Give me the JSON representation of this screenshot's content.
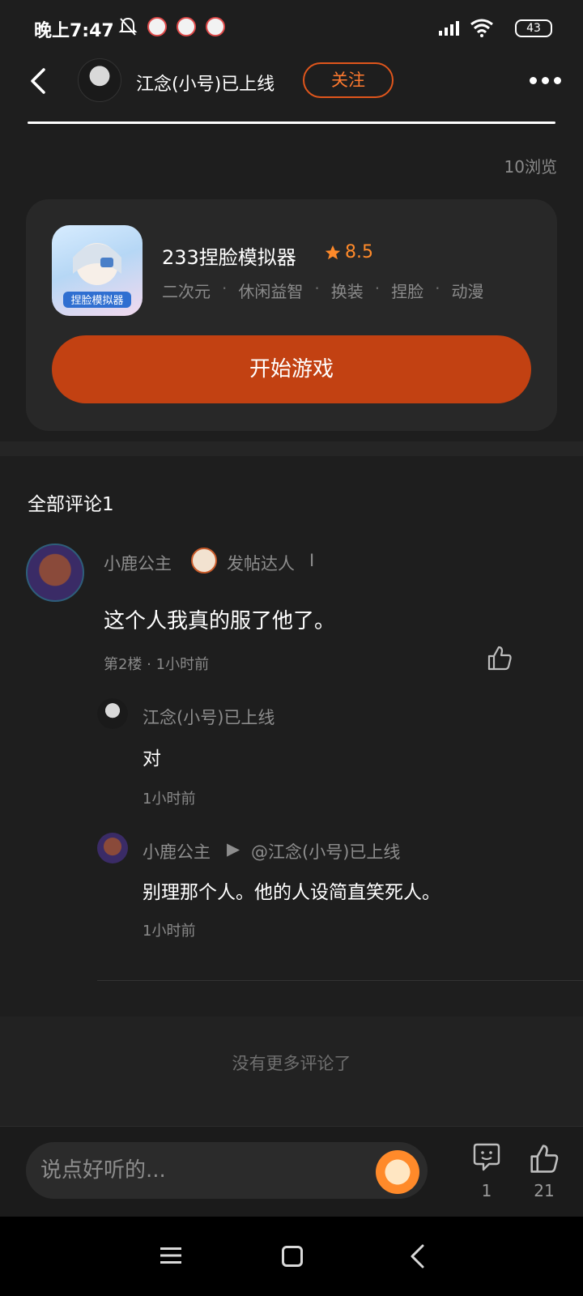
{
  "status_bar": {
    "time": "晚上7:47",
    "battery": "43"
  },
  "header": {
    "username": "江念(小号)已上线",
    "follow_label": "关注"
  },
  "post": {
    "views": "10浏览"
  },
  "game_card": {
    "title": "233捏脸模拟器",
    "rating": "8.5",
    "tags": [
      "二次元",
      "休闲益智",
      "换装",
      "捏脸",
      "动漫"
    ],
    "start_label": "开始游戏",
    "accent_color": "#c24112"
  },
  "comments": {
    "header": "全部评论1",
    "main": {
      "author": "小鹿公主",
      "badge": "发帖达人",
      "badge_level": "I",
      "text": "这个人我真的服了他了。",
      "meta": "第2楼 · 1小时前"
    },
    "replies": [
      {
        "author": "江念(小号)已上线",
        "text": "对",
        "meta": "1小时前"
      },
      {
        "author": "小鹿公主",
        "reply_to": "@江念(小号)已上线",
        "text": "别理那个人。他的人设简直笑死人。",
        "meta": "1小时前"
      }
    ],
    "no_more": "没有更多评论了"
  },
  "bottom_bar": {
    "input_placeholder": "说点好听的...",
    "comment_count": "1",
    "like_count": "21"
  }
}
